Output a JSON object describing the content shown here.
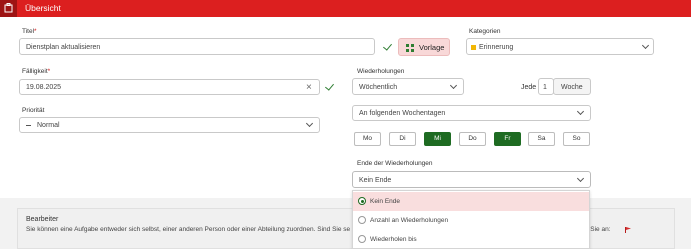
{
  "header": {
    "title": "Übersicht",
    "menu_icon": "app-menu-icon"
  },
  "form": {
    "title_label": "Titel",
    "title_value": "Dienstplan aktualisieren",
    "template_button": "Vorlage",
    "category_label": "Kategorien",
    "category_value": "Erinnerung",
    "category_color": "#f2b705",
    "due_label": "Fälligkeit",
    "due_value": "19.08.2025",
    "priority_label": "Priorität",
    "priority_value": "Normal",
    "recurrence_label": "Wiederholungen",
    "recurrence_value": "Wöchentlich",
    "every_label": "Jede",
    "every_value": "1",
    "every_unit": "Woche",
    "weekday_mode": "An folgenden Wochentagen",
    "weekdays": [
      {
        "label": "Mo",
        "active": false
      },
      {
        "label": "Di",
        "active": false
      },
      {
        "label": "Mi",
        "active": true
      },
      {
        "label": "Do",
        "active": false
      },
      {
        "label": "Fr",
        "active": true
      },
      {
        "label": "Sa",
        "active": false
      },
      {
        "label": "So",
        "active": false
      }
    ],
    "end_label": "Ende der Wiederholungen",
    "end_value": "Kein Ende",
    "end_options": [
      {
        "label": "Kein Ende",
        "selected": true
      },
      {
        "label": "Anzahl an Wiederholungen",
        "selected": false
      },
      {
        "label": "Wiederholen bis",
        "selected": false
      }
    ]
  },
  "assignee": {
    "heading": "Bearbeiter",
    "description": "Sie können eine Aufgabe entweder sich selbst, einer anderen Person oder einer Abteilung zuordnen. Sind Sie se",
    "description_tail": "nnen Sie an:"
  },
  "colors": {
    "accent": "#dc1f1f",
    "active_day": "#1e6b22",
    "selected_option": "#f9dede"
  }
}
